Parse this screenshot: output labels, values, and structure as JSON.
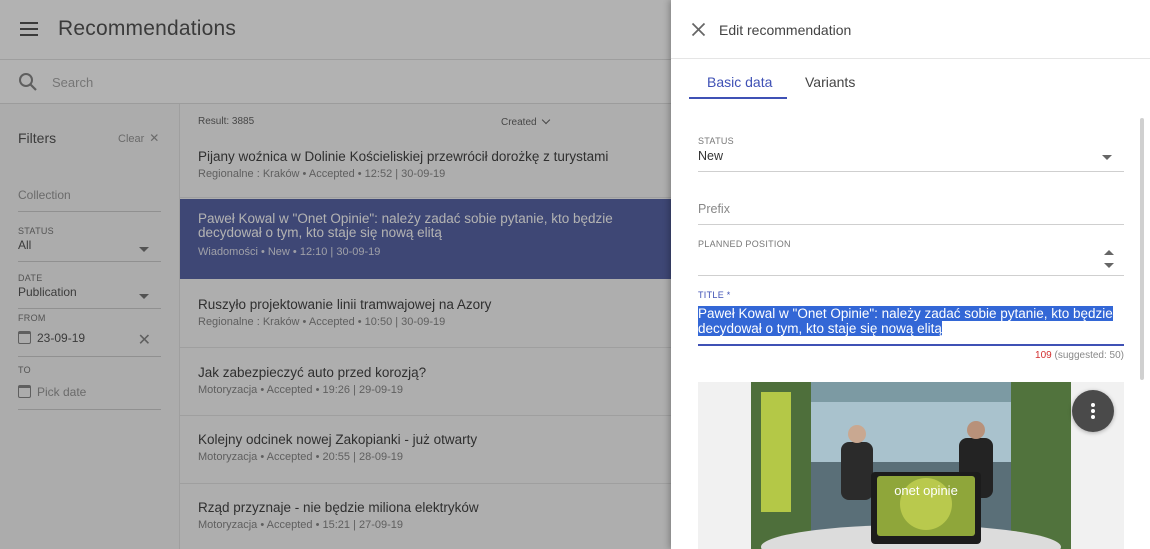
{
  "header": {
    "title": "Recommendations",
    "menu_icon": "hamburger-menu-icon"
  },
  "search": {
    "placeholder": "Search",
    "icon": "search-icon"
  },
  "filters": {
    "title": "Filters",
    "clear_label": "Clear",
    "collection_placeholder": "Collection",
    "status": {
      "label": "STATUS",
      "value": "All"
    },
    "date": {
      "label": "DATE",
      "value": "Publication"
    },
    "from": {
      "label": "FROM",
      "value": "23-09-19"
    },
    "to": {
      "label": "TO",
      "placeholder": "Pick date"
    }
  },
  "list": {
    "result_label": "Result: 3885",
    "sort_label": "Created",
    "items": [
      {
        "title": "Pijany woźnica w Dolinie Kościeliskiej przewrócił dorożkę z turystami",
        "meta": "Regionalne : Kraków • Accepted • 12:52 | 30-09-19"
      },
      {
        "title": "Paweł Kowal w \"Onet Opinie\": należy zadać sobie pytanie, kto będzie decydował o tym, kto staje się nową elitą",
        "meta": "Wiadomości • New • 12:10 | 30-09-19"
      },
      {
        "title": "Ruszyło projektowanie linii tramwajowej na Azory",
        "meta": "Regionalne : Kraków • Accepted • 10:50 | 30-09-19"
      },
      {
        "title": "Jak zabezpieczyć auto przed korozją?",
        "meta": "Motoryzacja • Accepted • 19:26 | 29-09-19"
      },
      {
        "title": "Kolejny odcinek nowej Zakopianki - już otwarty",
        "meta": "Motoryzacja • Accepted • 20:55 | 28-09-19"
      },
      {
        "title": "Rząd przyznaje - nie będzie miliona elektryków",
        "meta": "Motoryzacja • Accepted • 15:21 | 27-09-19"
      }
    ]
  },
  "drawer": {
    "title": "Edit recommendation",
    "tabs": [
      {
        "label": "Basic data"
      },
      {
        "label": "Variants"
      }
    ],
    "status": {
      "label": "STATUS",
      "value": "New"
    },
    "prefix": {
      "placeholder": "Prefix"
    },
    "planned_position": {
      "label": "PLANNED POSITION",
      "value": ""
    },
    "title_field": {
      "label": "TITLE *",
      "line1": "Paweł Kowal w \"Onet Opinie\": należy zadać sobie pytanie, kto będzie",
      "line2": "decydował o tym, kto staje się nową elitą"
    },
    "char_count": {
      "count": "109",
      "suggested": "(suggested: 50)"
    },
    "image_caption": "onet opinie"
  },
  "colors": {
    "accent": "#3f51b5",
    "selected_row": "#5a66a8",
    "over_limit": "#d32f2f"
  }
}
